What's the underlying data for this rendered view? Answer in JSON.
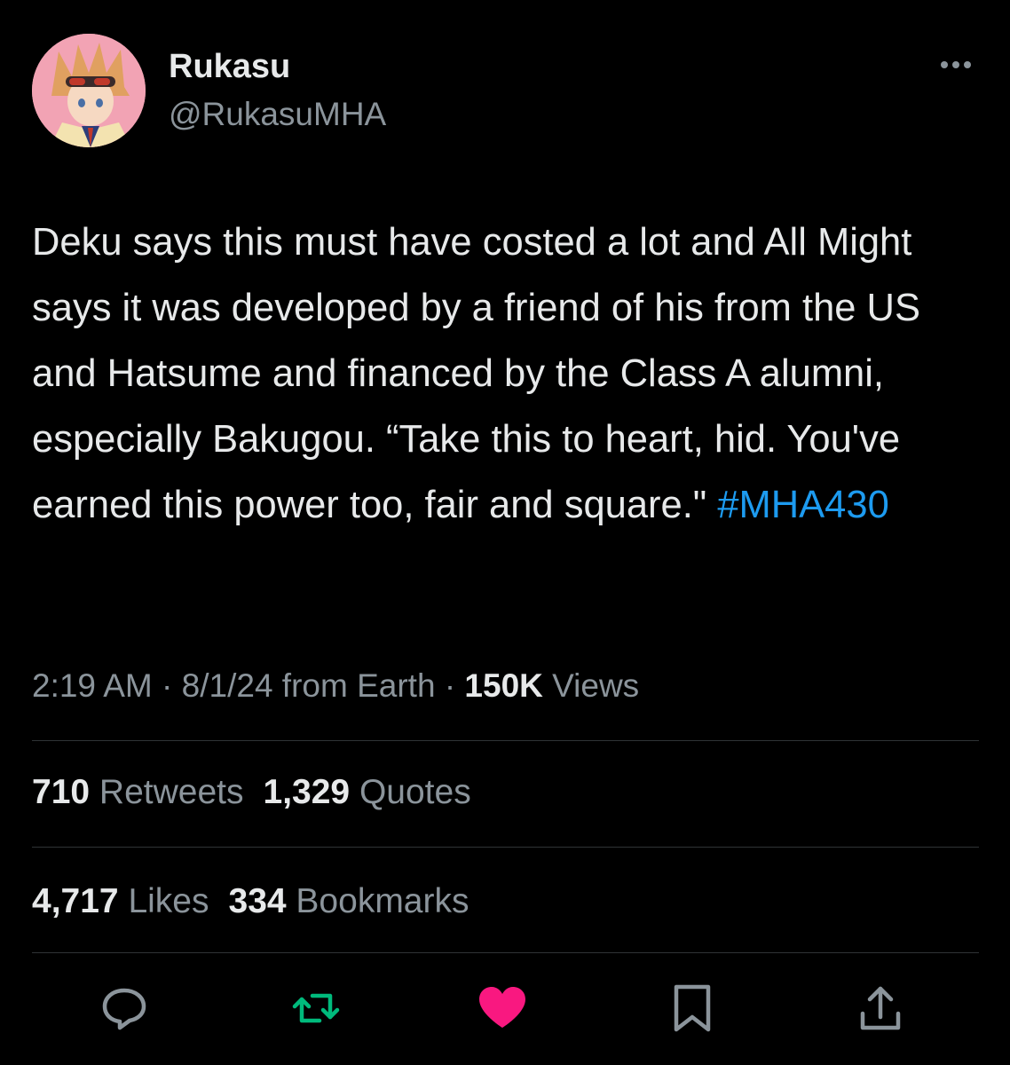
{
  "author": {
    "display_name": "Rukasu",
    "handle": "@RukasuMHA"
  },
  "tweet": {
    "text": "Deku says this must have costed a lot and All Might says it was developed by a friend of his from the US and Hatsume and financed by the Class A alumni, especially Bakugou. “Take this to heart, hid. You've earned this power too, fair and square.\" ",
    "hashtag": "#MHA430"
  },
  "meta": {
    "time": "2:19 AM",
    "sep1": "·",
    "date_source": "8/1/24 from Earth",
    "sep2": "·",
    "views_count": "150K",
    "views_label": "Views"
  },
  "stats": {
    "retweets_count": "710",
    "retweets_label": "Retweets",
    "quotes_count": "1,329",
    "quotes_label": "Quotes",
    "likes_count": "4,717",
    "likes_label": "Likes",
    "bookmarks_count": "334",
    "bookmarks_label": "Bookmarks"
  },
  "actions": {
    "reply_icon": "reply-icon",
    "retweet_icon": "retweet-icon",
    "like_icon": "heart-icon",
    "bookmark_icon": "bookmark-icon",
    "share_icon": "share-icon"
  },
  "colors": {
    "background": "#000000",
    "text_primary": "#e7e9ea",
    "text_secondary": "#8b949b",
    "link": "#1d9bf0",
    "retweet_active": "#00ba7c",
    "like_active": "#f91880",
    "divider": "#2f3336"
  }
}
